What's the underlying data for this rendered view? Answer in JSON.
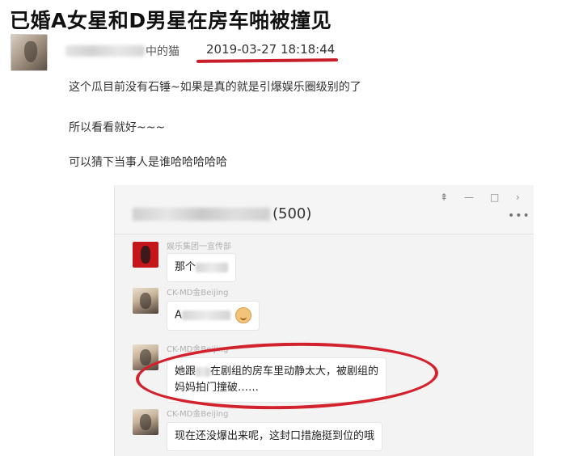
{
  "headline": "已婚A女星和D男星在房车啪被撞见",
  "post": {
    "username": "中的猫",
    "timestamp": "2019-03-27  18:18:44",
    "lines": [
      "这个瓜目前没有石锤~如果是真的就是引爆娱乐圈级别的了",
      "所以看看就好~~~",
      "可以猜下当事人是谁哈哈哈哈哈"
    ]
  },
  "chat_window": {
    "group_count": "(500)",
    "window_controls": [
      "pin-icon",
      "minimize-icon",
      "maximize-icon",
      "close-icon"
    ],
    "messages": [
      {
        "sender": "娱乐集团一宣传部",
        "text_before": "那个",
        "text_after": ""
      },
      {
        "sender": "CK-MD金Beijing",
        "text_before": "A",
        "text_after": ""
      },
      {
        "sender": "CK-MD金Beijing",
        "text_before": "她跟",
        "text_after": "在剧组的房车里动静太大，被剧组的",
        "line2": "妈妈拍门撞破……"
      },
      {
        "sender": "CK-MD金Beijing",
        "text_before": "现在还没爆出来呢，这封口措施挺到位的哦",
        "text_after": ""
      }
    ]
  },
  "colors": {
    "highlight_red": "#d2222d",
    "underline_red": "#c81e2a"
  }
}
